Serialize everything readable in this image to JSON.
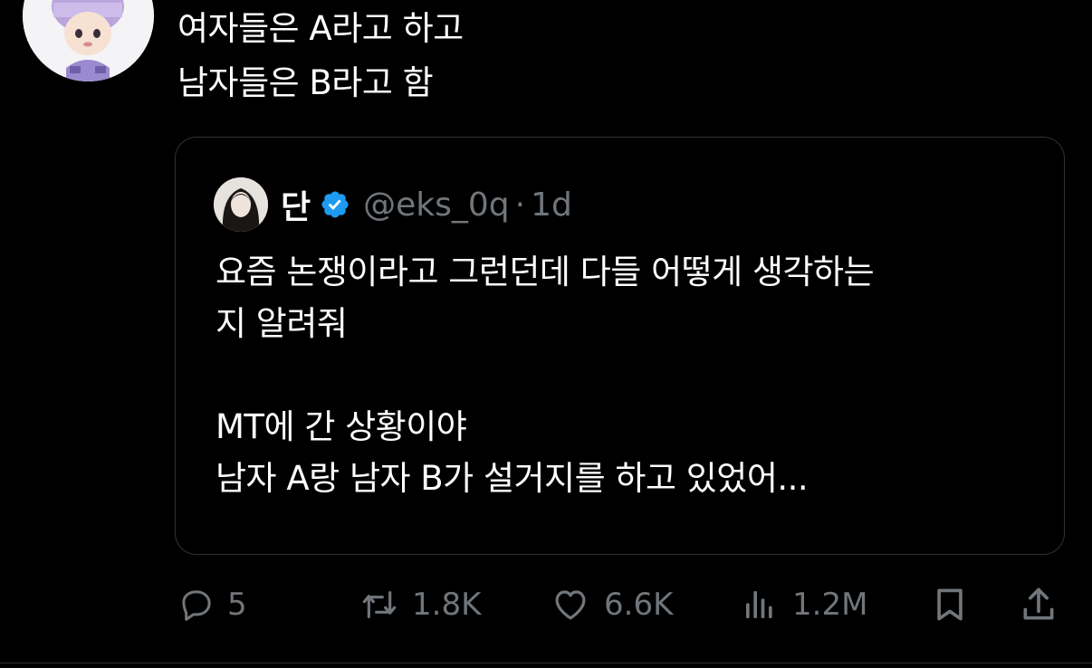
{
  "post": {
    "text_lines": [
      "여자들은 A라고 하고",
      "남자들은 B라고 함"
    ]
  },
  "quote": {
    "author_name": "단",
    "handle": "@eks_0q",
    "separator": "·",
    "time": "1d",
    "body_lines": [
      "요즘 논쟁이라고 그런던데 다들 어떻게 생각하는",
      "지 알려줘",
      "",
      "MT에 간 상황이야",
      "남자 A랑 남자 B가 설거지를 하고 있었어..."
    ]
  },
  "actions": {
    "replies": "5",
    "reposts": "1.8K",
    "likes": "6.6K",
    "views": "1.2M"
  },
  "colors": {
    "background": "#000000",
    "text_primary": "#ffffff",
    "text_secondary": "#71767b",
    "border": "#2f3336",
    "verified": "#1d9bf0"
  },
  "icons": {
    "reply": "reply-icon",
    "repost": "repost-icon",
    "like": "heart-icon",
    "views": "views-icon",
    "bookmark": "bookmark-icon",
    "share": "share-icon",
    "verified": "verified-badge-icon"
  }
}
